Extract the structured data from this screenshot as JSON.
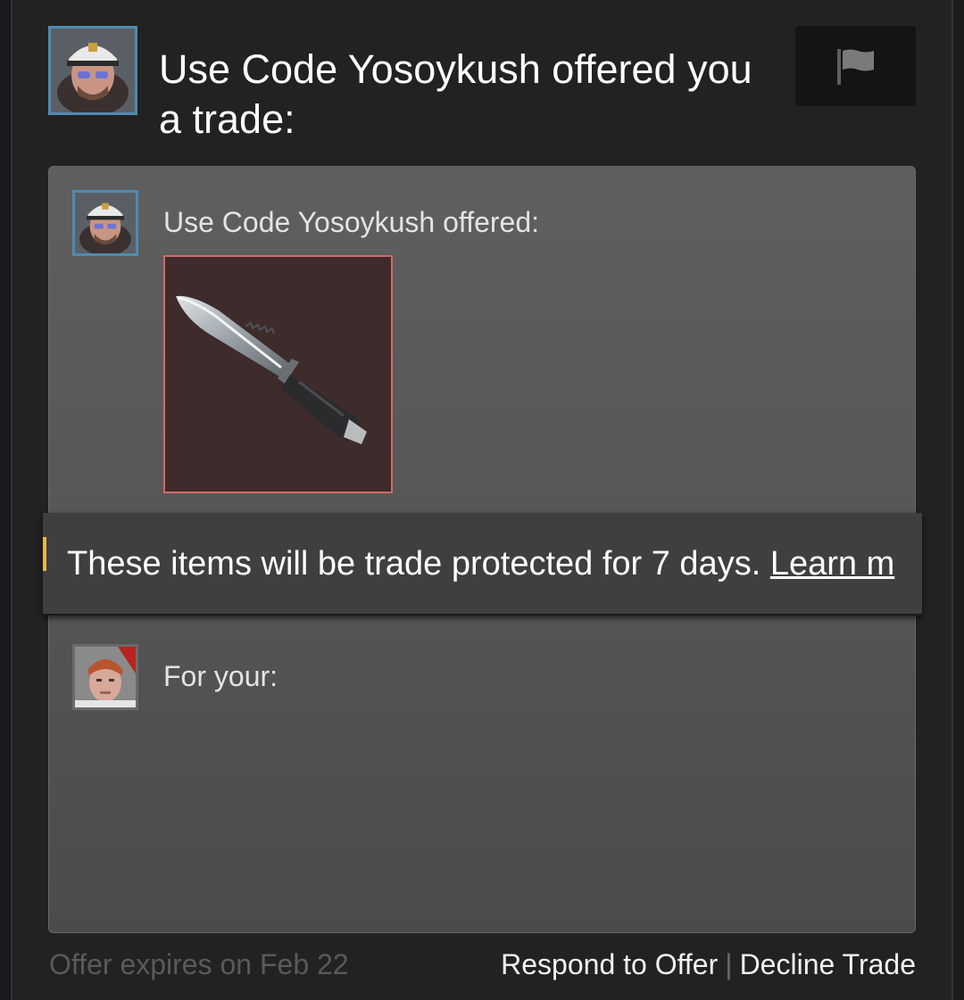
{
  "offer": {
    "headline": "Use Code Yosoykush offered you a trade:",
    "report_icon": "flag-icon",
    "partner_avatar_icon": "captain-hat-avatar",
    "your_avatar_icon": "red-hair-avatar",
    "offered_label": "Use Code Yosoykush offered:",
    "offered_item_icon": "bowie-knife-icon",
    "for_label": "For your:",
    "protection_notice": "These items will be trade protected for 7 days.",
    "learn_more_label": "Learn m",
    "expires_text": "Offer expires on Feb 22",
    "respond_label": "Respond to Offer",
    "separator": "|",
    "decline_label": "Decline Trade"
  },
  "colors": {
    "avatar_border": "#4f8bb0",
    "item_border": "#d06a66",
    "item_background": "#3e2b2b",
    "notice_accent": "#e8b84a"
  }
}
